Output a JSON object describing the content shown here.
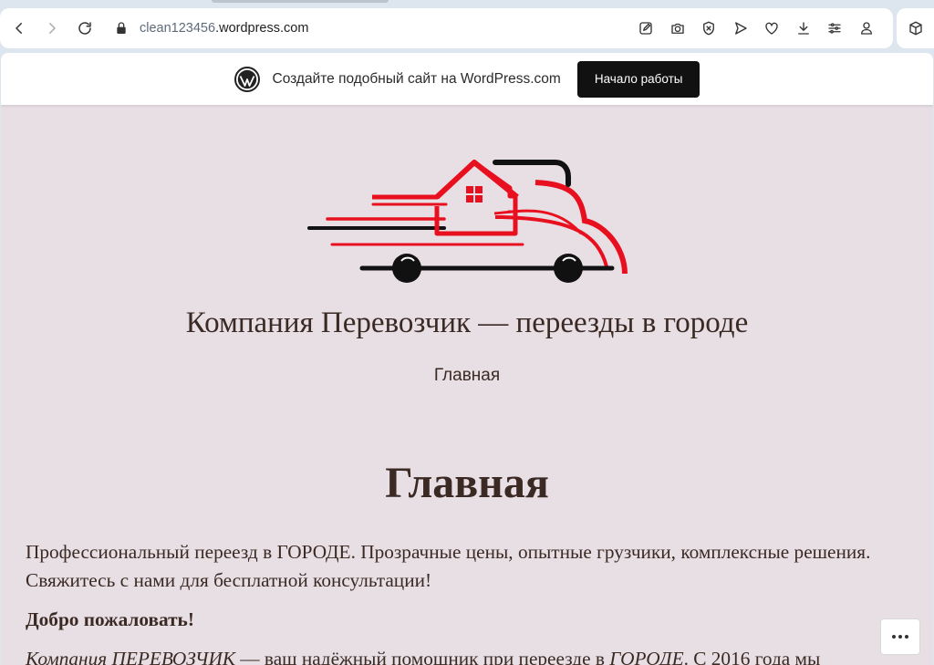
{
  "browser": {
    "url_subdomain": "clean123456",
    "url_domain": ".wordpress.com",
    "icons": [
      "back-icon",
      "forward-icon",
      "reload-icon",
      "lock-icon",
      "edit-icon",
      "camera-icon",
      "shield-icon",
      "send-icon",
      "heart-icon",
      "download-icon",
      "settings-sliders-icon",
      "profile-icon",
      "extension-cube-icon"
    ]
  },
  "wp_banner": {
    "text": "Создайте подобный сайт на WordPress.com",
    "button": "Начало работы"
  },
  "site": {
    "title": "Компания Перевозчик — переезды в городе",
    "nav_home": "Главная"
  },
  "page": {
    "heading": "Главная",
    "intro": "Профессиональный переезд в ГОРОДЕ. Прозрачные цены, опытные грузчики, комплексные решения. Свяжитесь с нами для бесплатной консультации!",
    "welcome": "Добро пожаловать!",
    "body_em1": "Компания ПЕРЕВОЗЧИК",
    "body_mid": " — ваш надёжный помощник при переезде в ",
    "body_em2": "ГОРОДЕ",
    "body_end": ". С 2016 года мы"
  },
  "colors": {
    "page_bg": "#e8dfe5",
    "text": "#3b2a24",
    "logo_red": "#e8101f",
    "logo_black": "#111111"
  }
}
